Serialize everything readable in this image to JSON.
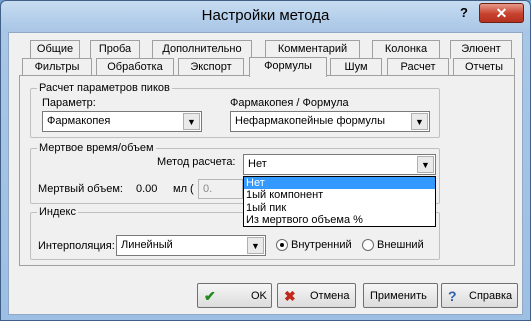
{
  "window": {
    "title": "Настройки метода",
    "help": "?",
    "close": "✕"
  },
  "tabs_row1": [
    "Общие",
    "Проба",
    "Дополнительно",
    "Комментарий",
    "Колонка",
    "Элюент"
  ],
  "tabs_row2": [
    "Фильтры",
    "Обработка",
    "Экспорт",
    "Формулы",
    "Шум",
    "Расчет",
    "Отчеты"
  ],
  "active_tab": "Формулы",
  "peaks_group": {
    "legend": "Расчет параметров пиков",
    "param_label": "Параметр:",
    "param_value": "Фармакопея",
    "formula_label": "Фармакопея / Формула",
    "formula_value": "Нефармакопейные  формулы"
  },
  "deadtime_group": {
    "legend": "Мертвое время/объем",
    "method_label": "Метод расчета:",
    "method_value": "Нет",
    "volume_label": "Мертвый объем:",
    "volume_value": "0.00",
    "volume_unit": "мл (",
    "field_value": "0."
  },
  "dropdown_options": [
    "Нет",
    "1ый компонент",
    "1ый пик",
    "Из мертвого объема %"
  ],
  "index_group": {
    "legend": "Индекс",
    "interp_label": "Интерполяция:",
    "interp_value": "Линейный",
    "radio_internal": "Внутренний",
    "radio_external": "Внешний"
  },
  "buttons": {
    "ok": "OK",
    "cancel": "Отмена",
    "apply": "Применить",
    "help": "Справка"
  },
  "colors": {
    "ok_check": "#1f8a1f",
    "cancel_x": "#c0281c",
    "help_q": "#2f5fb0",
    "selection": "#3399ff"
  }
}
